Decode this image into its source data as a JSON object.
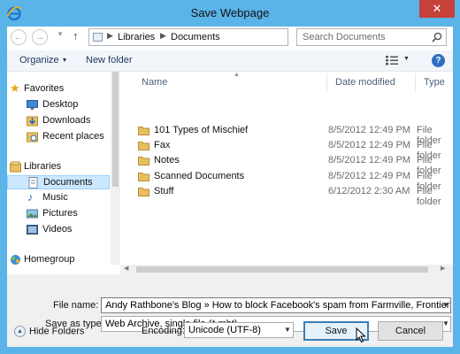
{
  "window": {
    "title": "Save Webpage",
    "close_glyph": "✕"
  },
  "address": {
    "crumbs": [
      "Libraries",
      "Documents"
    ],
    "search_placeholder": "Search Documents"
  },
  "toolbar": {
    "organize": "Organize",
    "new_folder": "New folder"
  },
  "nav": {
    "items": [
      {
        "label": "Favorites",
        "icon": "star-icon"
      },
      {
        "label": "Desktop",
        "icon": "desktop-icon"
      },
      {
        "label": "Downloads",
        "icon": "downloads-icon"
      },
      {
        "label": "Recent places",
        "icon": "recent-places-icon"
      },
      {
        "label": "Libraries",
        "icon": "libraries-icon"
      },
      {
        "label": "Documents",
        "icon": "documents-icon"
      },
      {
        "label": "Music",
        "icon": "music-icon"
      },
      {
        "label": "Pictures",
        "icon": "pictures-icon"
      },
      {
        "label": "Videos",
        "icon": "videos-icon"
      },
      {
        "label": "Homegroup",
        "icon": "homegroup-icon"
      }
    ],
    "selected": "Documents"
  },
  "files": {
    "columns": {
      "name": "Name",
      "date": "Date modified",
      "type": "Type"
    },
    "rows": [
      {
        "name": "101 Types of Mischief",
        "date": "8/5/2012 12:49 PM",
        "type": "File folder"
      },
      {
        "name": "Fax",
        "date": "8/5/2012 12:49 PM",
        "type": "File folder"
      },
      {
        "name": "Notes",
        "date": "8/5/2012 12:49 PM",
        "type": "File folder"
      },
      {
        "name": "Scanned Documents",
        "date": "8/5/2012 12:49 PM",
        "type": "File folder"
      },
      {
        "name": "Stuff",
        "date": "6/12/2012 2:30 AM",
        "type": "File folder"
      }
    ]
  },
  "form": {
    "file_name_label": "File name:",
    "file_name_value": "Andy Rathbone's Blog » How to block Facebook's spam from Farmville, FrontierVille, C",
    "save_type_label": "Save as type:",
    "save_type_value": "Web Archive, single file (*.mht)",
    "encoding_label": "Encoding:",
    "encoding_value": "Unicode (UTF-8)"
  },
  "buttons": {
    "hide_folders": "Hide Folders",
    "save": "Save",
    "cancel": "Cancel"
  },
  "colors": {
    "frame": "#5ab4e8",
    "close": "#c7413a",
    "selection": "#cce8ff",
    "folder": "#e8c062"
  }
}
